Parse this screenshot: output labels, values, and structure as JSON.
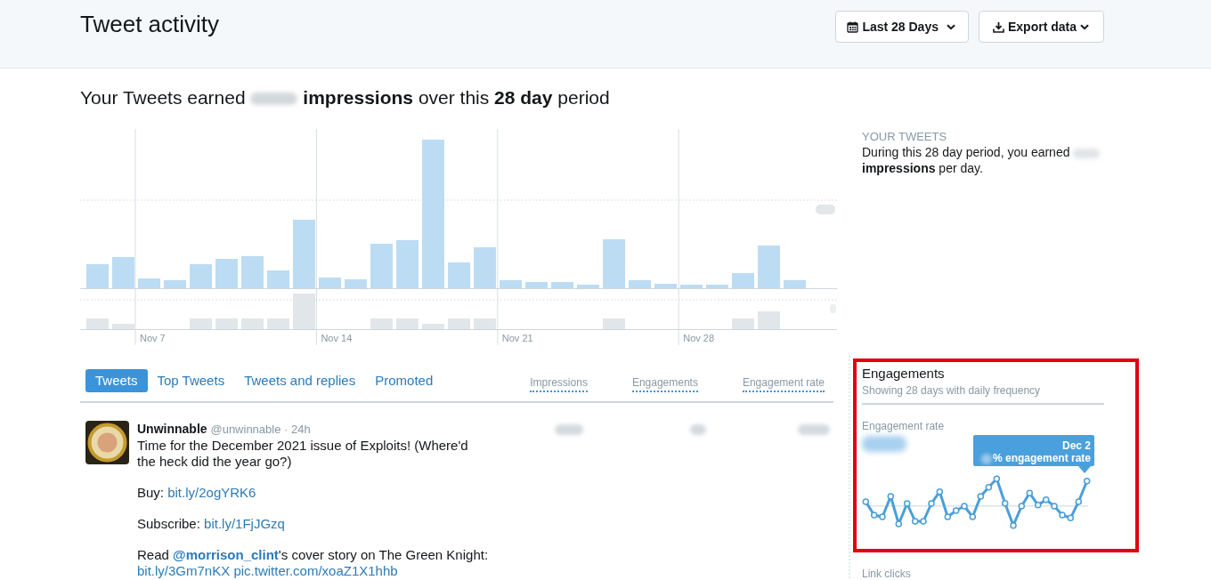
{
  "header": {
    "title": "Tweet activity",
    "buttons": [
      {
        "kind": "calendar",
        "label": "Last 28 Days"
      },
      {
        "kind": "download",
        "label": "Export data"
      }
    ]
  },
  "headline": {
    "before": "Your Tweets earned",
    "after": "**impressions** over this **28 day** period"
  },
  "impressions_chart": {
    "date_labels": [
      "Nov 7",
      "Nov 14",
      "Nov 21",
      "Nov 28"
    ]
  },
  "tabs": [
    {
      "label": "Tweets",
      "selected": true
    },
    {
      "label": "Top Tweets",
      "selected": false
    },
    {
      "label": "Tweets and replies",
      "selected": false
    },
    {
      "label": "Promoted",
      "selected": false
    }
  ],
  "metric_columns": [
    "Impressions",
    "Engagements",
    "Engagement rate"
  ],
  "tweets": [
    {
      "name": "Unwinnable",
      "meta": "@unwinnable · 24h",
      "paragraphs": [
        [
          {
            "kind": "text",
            "text": "Time for the December 2021 issue of Exploits! (Where'd the heck did the year go?)"
          }
        ],
        [
          {
            "kind": "text",
            "text": "Buy: "
          },
          {
            "kind": "link",
            "text": "bit.ly/2ogYRK6"
          }
        ],
        [
          {
            "kind": "text",
            "text": "Subscribe: "
          },
          {
            "kind": "link",
            "text": "bit.ly/1FjJGzq"
          }
        ],
        [
          {
            "kind": "text",
            "text": "Read "
          },
          {
            "kind": "mention",
            "text": "@morrison_clint"
          },
          {
            "kind": "text",
            "text": "'s cover story on The Green Knight: "
          },
          {
            "kind": "link",
            "text": "bit.ly/3Gm7nKX"
          },
          {
            "kind": "link",
            "text": "pic.twitter.com/xoaZ1X1hhb"
          }
        ]
      ]
    }
  ],
  "sidebar": {
    "heading": "YOUR TWEETS",
    "before": "During this 28 day period, you earned",
    "after": "**impressions** per day."
  },
  "engagements_card": {
    "title": "Engagements",
    "subtitle": "Showing 28 days with daily frequency",
    "metric_label": "Engagement rate",
    "tooltip": {
      "date": "Dec 2",
      "text": "% engagement rate"
    }
  },
  "next_card": {
    "title": "Link clicks"
  }
}
